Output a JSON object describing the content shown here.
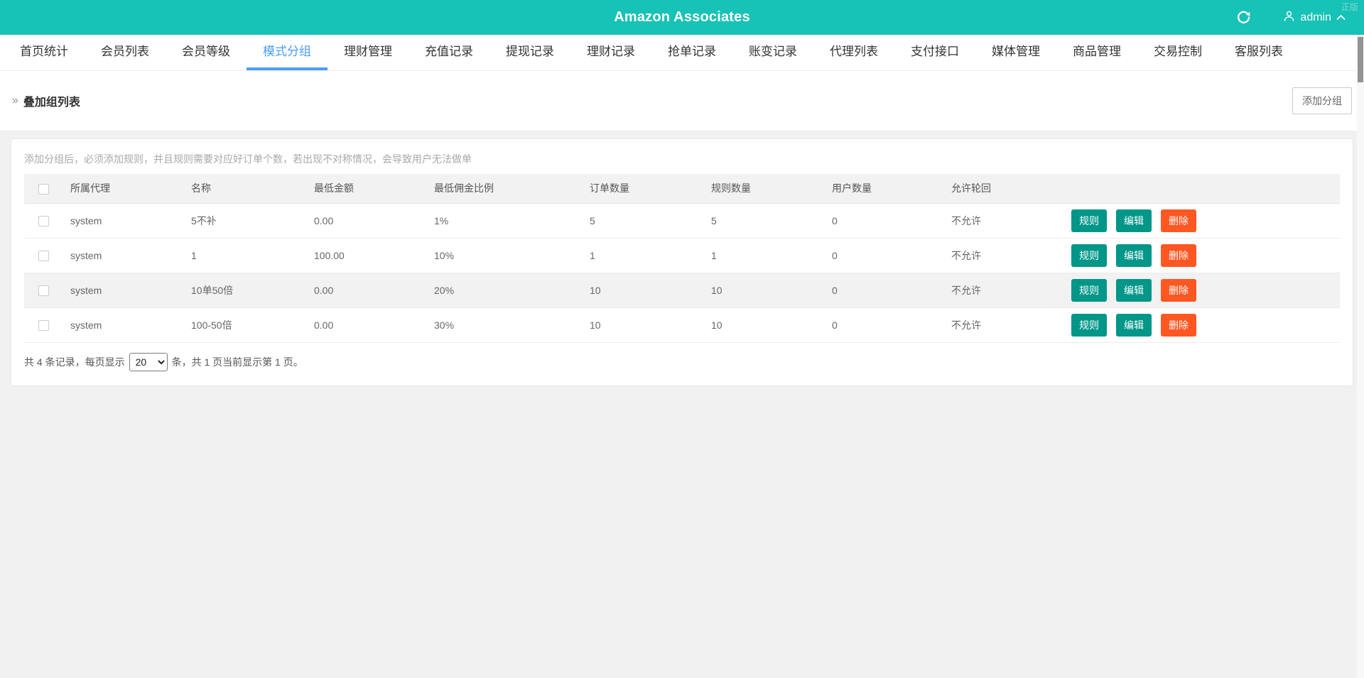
{
  "header": {
    "title": "Amazon Associates",
    "watermark": "正版",
    "user": "admin"
  },
  "nav": {
    "items": [
      {
        "label": "首页统计",
        "active": false
      },
      {
        "label": "会员列表",
        "active": false
      },
      {
        "label": "会员等级",
        "active": false
      },
      {
        "label": "模式分组",
        "active": true
      },
      {
        "label": "理财管理",
        "active": false
      },
      {
        "label": "充值记录",
        "active": false
      },
      {
        "label": "提现记录",
        "active": false
      },
      {
        "label": "理财记录",
        "active": false
      },
      {
        "label": "抢单记录",
        "active": false
      },
      {
        "label": "账变记录",
        "active": false
      },
      {
        "label": "代理列表",
        "active": false
      },
      {
        "label": "支付接口",
        "active": false
      },
      {
        "label": "媒体管理",
        "active": false
      },
      {
        "label": "商品管理",
        "active": false
      },
      {
        "label": "交易控制",
        "active": false
      },
      {
        "label": "客服列表",
        "active": false
      }
    ]
  },
  "breadcrumb": {
    "label": "叠加组列表"
  },
  "toolbar": {
    "add_group_label": "添加分组"
  },
  "content": {
    "hint": "添加分组后，必须添加规则，并且规则需要对应好订单个数，若出现不对称情况，会导致用户无法做单",
    "table": {
      "columns": [
        "所属代理",
        "名称",
        "最低金额",
        "最低佣金比例",
        "订单数量",
        "规则数量",
        "用户数量",
        "允许轮回"
      ],
      "rows": [
        {
          "agent": "system",
          "name": "5不补",
          "min_amount": "0.00",
          "min_commission": "1%",
          "orders": "5",
          "rules": "5",
          "users": "0",
          "loop": "不允许"
        },
        {
          "agent": "system",
          "name": "1",
          "min_amount": "100.00",
          "min_commission": "10%",
          "orders": "1",
          "rules": "1",
          "users": "0",
          "loop": "不允许"
        },
        {
          "agent": "system",
          "name": "10单50倍",
          "min_amount": "0.00",
          "min_commission": "20%",
          "orders": "10",
          "rules": "10",
          "users": "0",
          "loop": "不允许"
        },
        {
          "agent": "system",
          "name": "100-50倍",
          "min_amount": "0.00",
          "min_commission": "30%",
          "orders": "10",
          "rules": "10",
          "users": "0",
          "loop": "不允许"
        }
      ],
      "actions": {
        "rule": "规则",
        "edit": "编辑",
        "delete": "删除"
      }
    },
    "pagination": {
      "prefix": "共 4 条记录，每页显示",
      "page_size": "20",
      "suffix": "条，共 1 页当前显示第 1 页。"
    }
  },
  "colors": {
    "topbar": "#17c2b6",
    "nav_active": "#4b9df6",
    "button_teal": "#009688",
    "button_orange": "#ff5722"
  }
}
